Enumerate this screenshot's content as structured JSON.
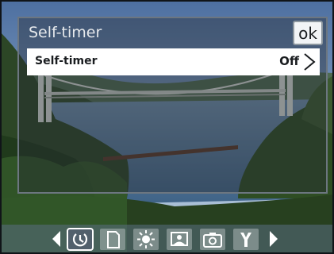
{
  "dialog": {
    "title": "Self-timer",
    "ok_label": "ok"
  },
  "setting": {
    "label": "Self-timer",
    "value": "Off"
  },
  "toolbar": {
    "icons": [
      "left-arrow-icon",
      "self-timer-icon",
      "storage-card-icon",
      "brightness-icon",
      "image-mode-icon",
      "camera-icon",
      "tools-icon",
      "right-arrow-icon"
    ],
    "selected_icon": "self-timer-icon"
  }
}
